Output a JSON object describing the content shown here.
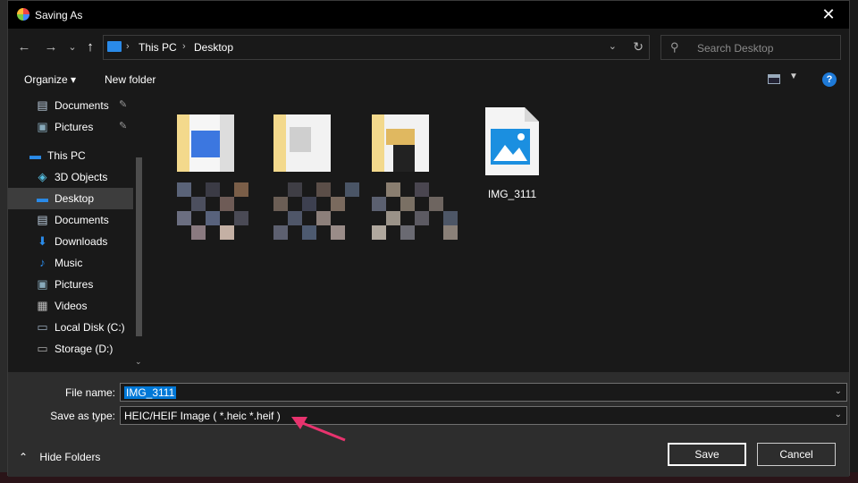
{
  "window": {
    "title": "Saving As",
    "close_glyph": "✕"
  },
  "nav": {
    "back_glyph": "←",
    "forward_glyph": "→",
    "recent_glyph": "⌄",
    "up_glyph": "↑",
    "breadcrumb": [
      "This PC",
      "Desktop"
    ],
    "search_placeholder": "Search Desktop"
  },
  "toolbar": {
    "organize": "Organize ▾",
    "new_folder": "New folder",
    "help": "?"
  },
  "tree": [
    {
      "label": "Documents",
      "icon": "document-icon",
      "pinned": true
    },
    {
      "label": "Pictures",
      "icon": "pictures-icon",
      "pinned": true
    },
    {
      "label": "This PC",
      "icon": "pc-icon",
      "pinned": false
    },
    {
      "label": "3D Objects",
      "icon": "3d-objects-icon",
      "pinned": false
    },
    {
      "label": "Desktop",
      "icon": "desktop-icon",
      "pinned": false,
      "selected": true
    },
    {
      "label": "Documents",
      "icon": "document-icon",
      "pinned": false
    },
    {
      "label": "Downloads",
      "icon": "download-icon",
      "pinned": false
    },
    {
      "label": "Music",
      "icon": "music-icon",
      "pinned": false
    },
    {
      "label": "Pictures",
      "icon": "pictures-icon",
      "pinned": false
    },
    {
      "label": "Videos",
      "icon": "video-icon",
      "pinned": false
    },
    {
      "label": "Local Disk (C:)",
      "icon": "disk-icon",
      "pinned": false
    },
    {
      "label": "Storage (D:)",
      "icon": "drive-icon",
      "pinned": false
    }
  ],
  "files": [
    {
      "name": "IMG_3111",
      "icon": "image-file-icon"
    }
  ],
  "form": {
    "file_name_label": "File name:",
    "file_name_value": "IMG_3111",
    "type_label": "Save as type:",
    "type_value": "HEIC/HEIF Image ( *.heic *.heif )"
  },
  "footer": {
    "hide_folders": "Hide Folders",
    "save": "Save",
    "cancel": "Cancel"
  },
  "colors": {
    "accent": "#0078d7",
    "arrow": "#e8336e",
    "folder": "#f5d38a"
  }
}
